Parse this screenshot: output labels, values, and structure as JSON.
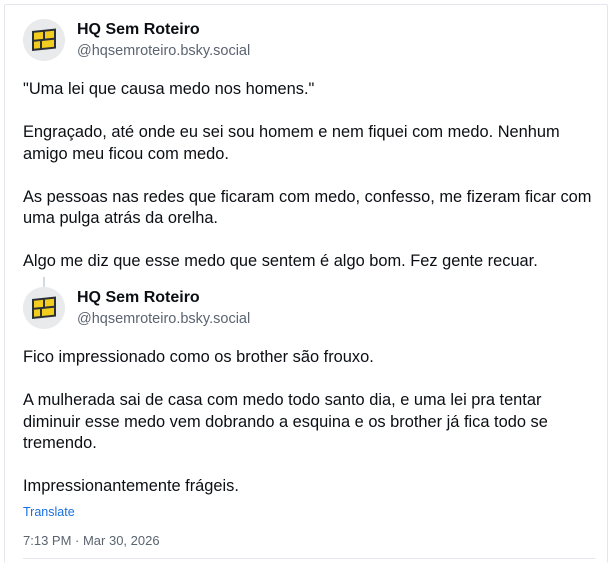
{
  "posts": [
    {
      "display_name": "HQ Sem Roteiro",
      "handle": "@hqsemroteiro.bsky.social",
      "avatar_icon": "hq-sem-roteiro-logo-icon",
      "paragraphs": [
        "\"Uma lei que causa medo nos homens.\"",
        "Engraçado, até onde eu sei sou homem e nem fiquei com medo. Nenhum amigo meu ficou com medo.",
        "As pessoas nas redes que ficaram com medo, confesso, me fizeram ficar com uma pulga atrás da orelha.",
        "Algo me diz que esse medo que sentem é algo bom. Fez gente recuar."
      ]
    },
    {
      "display_name": "HQ Sem Roteiro",
      "handle": "@hqsemroteiro.bsky.social",
      "avatar_icon": "hq-sem-roteiro-logo-icon",
      "paragraphs": [
        "Fico impressionado como os brother são frouxo.",
        "A mulherada sai de casa com medo todo santo dia, e uma lei pra tentar diminuir esse medo vem dobrando a esquina e os brother já fica todo se tremendo.",
        "Impressionantemente frágeis."
      ]
    }
  ],
  "translate_label": "Translate",
  "timestamp": "7:13 PM · Mar 30, 2026",
  "colors": {
    "link": "#1a6fe0",
    "muted": "#5b6471",
    "logo_yellow": "#f2cd1f",
    "logo_dark": "#2b2f36"
  }
}
